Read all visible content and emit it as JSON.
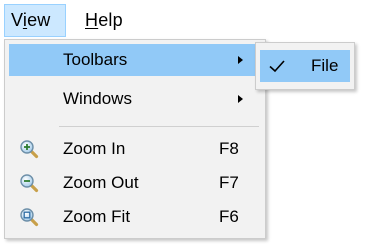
{
  "menubar": {
    "view": {
      "label_prefix": "V",
      "label_mnemonic": "i",
      "label_suffix": "ew"
    },
    "help": {
      "label_mnemonic": "H",
      "label_suffix": "elp"
    }
  },
  "view_menu": {
    "items": [
      {
        "label": "Toolbars",
        "shortcut": "",
        "has_submenu": true,
        "highlighted": true
      },
      {
        "label": "Windows",
        "shortcut": "",
        "has_submenu": true,
        "highlighted": false
      },
      {
        "label": "Zoom In",
        "shortcut": "F8",
        "icon": "zoom-in-icon"
      },
      {
        "label": "Zoom Out",
        "shortcut": "F7",
        "icon": "zoom-out-icon"
      },
      {
        "label": "Zoom Fit",
        "shortcut": "F6",
        "icon": "zoom-fit-icon"
      }
    ]
  },
  "toolbars_submenu": {
    "items": [
      {
        "label": "File",
        "checked": true
      }
    ]
  },
  "colors": {
    "highlight": "#91c9f7",
    "menubar_active": "#cce8ff",
    "menu_background": "#f2f2f2"
  }
}
